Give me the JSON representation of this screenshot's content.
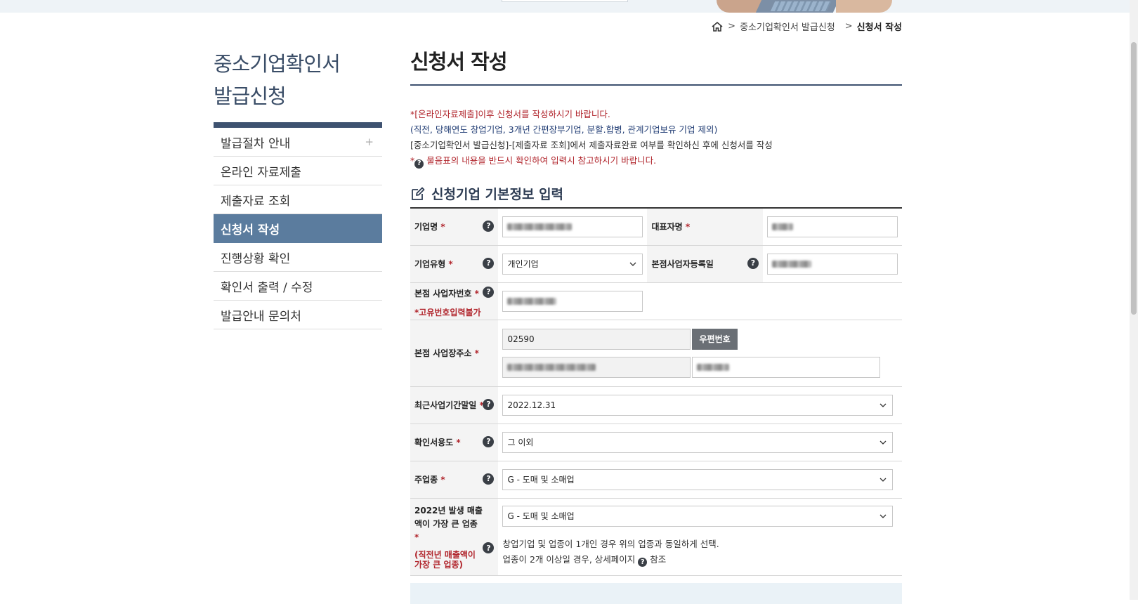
{
  "breadcrumb": {
    "items": [
      "중소기업확인서 발급신청",
      "신청서 작성"
    ]
  },
  "sidebar": {
    "title_line1": "중소기업확인서",
    "title_line2": "발급신청",
    "items": [
      {
        "label": "발급절차 안내",
        "expand": "+"
      },
      {
        "label": "온라인 자료제출"
      },
      {
        "label": "제출자료 조회"
      },
      {
        "label": "신청서 작성",
        "active": true
      },
      {
        "label": "진행상황 확인"
      },
      {
        "label": "확인서 출력 / 수정"
      },
      {
        "label": "발급안내 문의처"
      }
    ]
  },
  "main": {
    "page_title": "신청서 작성",
    "notices": {
      "line1": "*[온라인자료제출]이후 신청서를 작성하시기 바랍니다.",
      "line2": "(직전, 당해연도 창업기업, 3개년 간편장부기업, 분할.합병, 관계기업보유 기업 제외)",
      "line3": "[중소기업확인서 발급신청]-[제출자료 조회]에서 제출자료완료 여부를 확인하신 후에 신청서를 작성",
      "line4_prefix": "*",
      "line4": "물음표의 내용을 반드시 확인하여 입력시 참고하시기 바랍니다."
    },
    "section_title": "신청기업 기본정보 입력",
    "form": {
      "company_name_label": "기업명",
      "ceo_label": "대표자명",
      "company_type_label": "기업유형",
      "company_type_value": "개인기업",
      "reg_date_label": "본점사업자등록일",
      "biz_no_label": "본점 사업자번호",
      "biz_no_note": "*고유번호입력불가",
      "address_label": "본점 사업장주소",
      "postcode_value": "02590",
      "postcode_button": "우편번호",
      "fiscal_end_label": "최근사업기간말일",
      "fiscal_end_value": "2022.12.31",
      "purpose_label": "확인서용도",
      "purpose_value": "그 이외",
      "main_industry_label": "주업종",
      "main_industry_value": "G - 도매 및 소매업",
      "top_sales_label": "2022년 발생 매출액이 가장 큰 업종",
      "top_sales_sub": "(직전년 매출액이 가장 큰 업종)",
      "top_sales_value": "G - 도매 및 소매업",
      "help1": "창업기업 및 업종이 1개인 경우 위의 업종과 동일하게 선택.",
      "help2_prefix": "업종이 2개 이상일 경우, 상세페이지",
      "help2_suffix": "참조",
      "required_mark": "*"
    }
  },
  "icons": {
    "home": "home-icon",
    "question": "question-icon",
    "edit": "edit-icon",
    "chevron": "chevron-down-icon"
  },
  "colors": {
    "navy": "#3e5270",
    "active_menu": "#5b7c9e",
    "red": "#b1262d"
  }
}
